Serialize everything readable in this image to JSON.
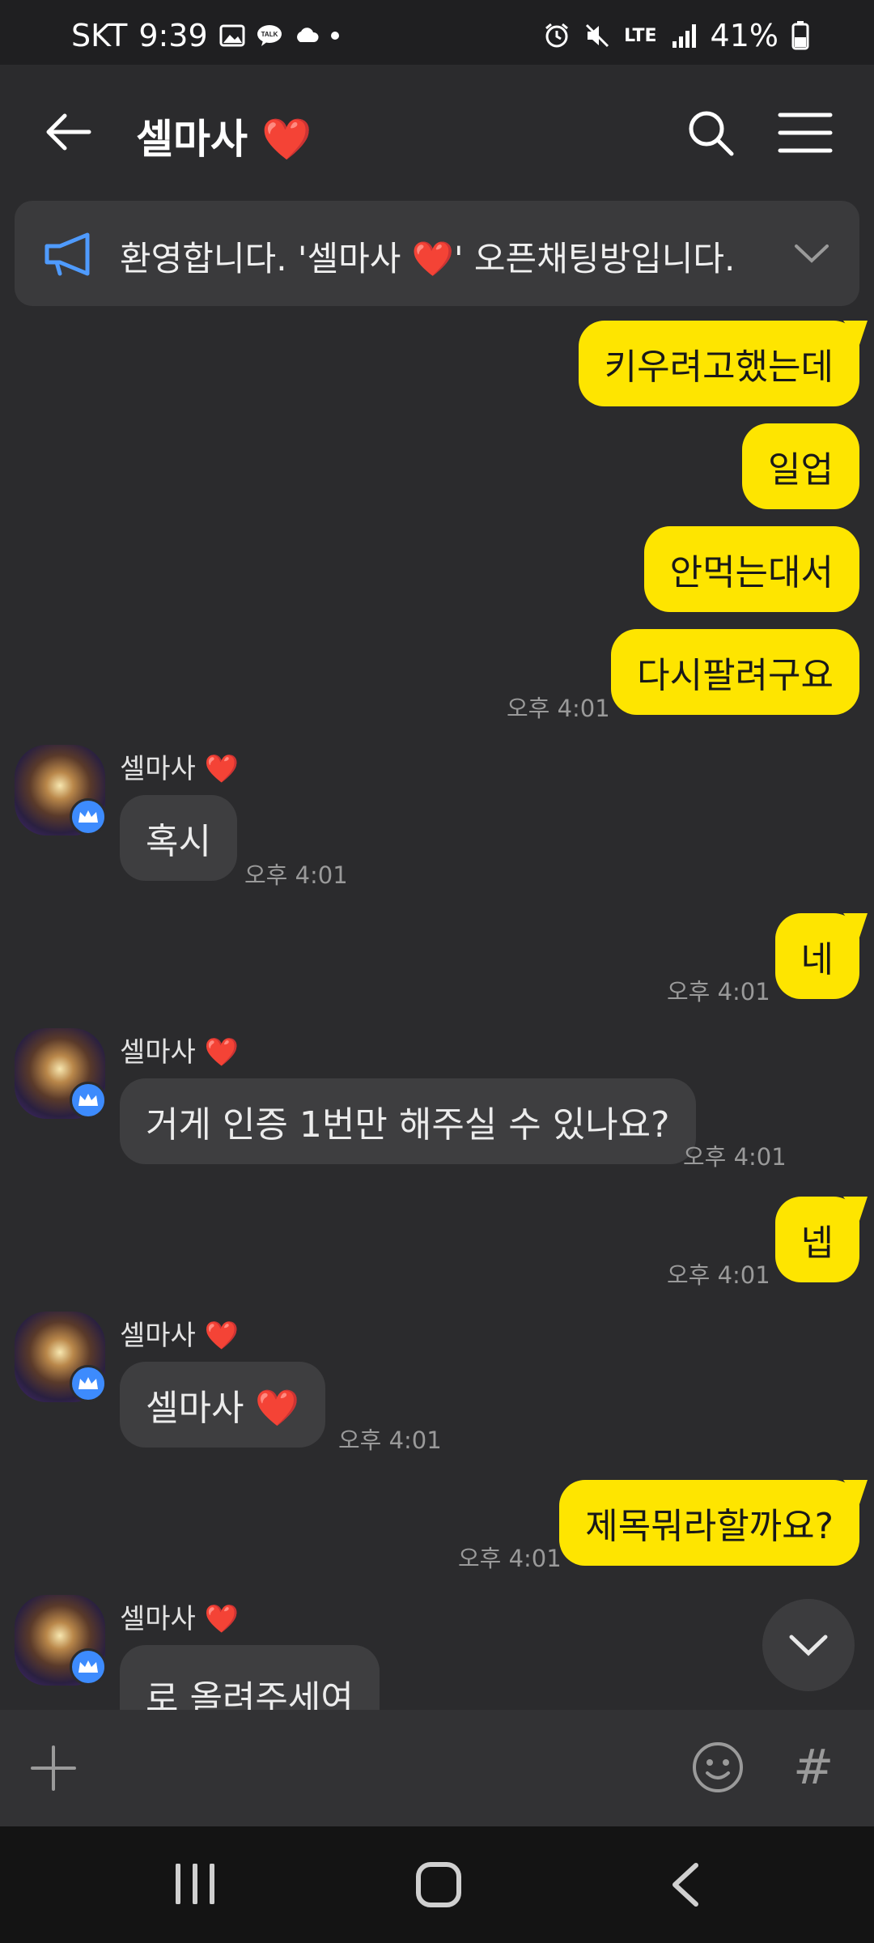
{
  "status_bar": {
    "carrier": "SKT",
    "time": "9:39",
    "network": "LTE",
    "battery": "41%"
  },
  "header": {
    "title": "셀마사 ❤️"
  },
  "notice": {
    "text": "환영합니다. '셀마사 ❤️' 오픈채팅방입니다."
  },
  "messages": {
    "m1": "키우려고했는데",
    "m2": "일업",
    "m3": "안먹는대서",
    "m4": "다시팔려구요",
    "m4_time": "오후 4:01",
    "o1_sender": "셀마사 ❤️",
    "o1": "혹시",
    "o1_time": "오후 4:01",
    "m5": "네",
    "m5_time": "오후 4:01",
    "o2_sender": "셀마사 ❤️",
    "o2": "거게 인증 1번만 해주실 수 있나요?",
    "o2_time": "오후 4:01",
    "m6": "넵",
    "m6_time": "오후 4:01",
    "o3_sender": "셀마사 ❤️",
    "o3": "셀마사 ❤️",
    "o3_time": "오후 4:01",
    "m7": "제목뭐라할까요?",
    "m7_time": "오후 4:01",
    "o4_sender": "셀마사 ❤️",
    "o4": "로 올려주세여"
  },
  "input_bar": {
    "hash": "#"
  },
  "colors": {
    "background": "#2b2b2d",
    "my_bubble": "#fee500",
    "other_bubble": "#3e3e40",
    "badge": "#3d8bfd"
  }
}
